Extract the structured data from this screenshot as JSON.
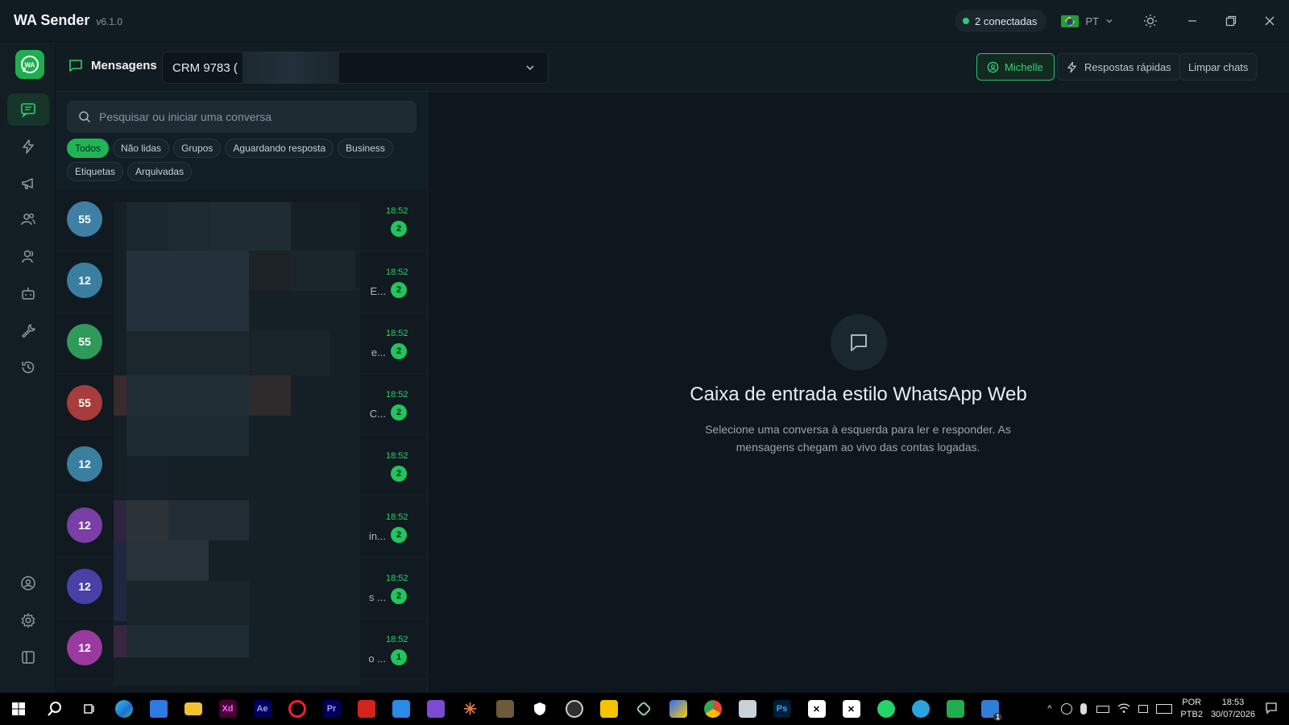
{
  "app": {
    "name": "WA Sender",
    "version": "v6.1.0"
  },
  "titlebar": {
    "connected_label": "2 conectadas",
    "language_code": "PT",
    "theme_icon": "sun-icon",
    "controls": [
      "minimize",
      "maximize",
      "close"
    ]
  },
  "rail": {
    "logo_text": "WA",
    "items": [
      {
        "name": "inbox",
        "icon": "chat-list-icon",
        "active": true
      },
      {
        "name": "automations",
        "icon": "bolt-icon"
      },
      {
        "name": "campaigns",
        "icon": "megaphone-icon"
      },
      {
        "name": "contacts",
        "icon": "users-icon"
      },
      {
        "name": "groups",
        "icon": "user-group-icon"
      },
      {
        "name": "bots",
        "icon": "robot-icon"
      },
      {
        "name": "tools",
        "icon": "wrench-icon"
      },
      {
        "name": "history",
        "icon": "history-icon"
      }
    ],
    "bottom": [
      {
        "name": "account",
        "icon": "account-icon"
      },
      {
        "name": "settings",
        "icon": "gear-icon"
      },
      {
        "name": "collapse",
        "icon": "sidebar-collapse-icon"
      }
    ]
  },
  "header": {
    "title": "Mensagens",
    "account_select_value": "CRM 9783 (",
    "attendant_button": "Michelle",
    "quick_replies_button": "Respostas rápidas",
    "clear_chats_button": "Limpar chats"
  },
  "search": {
    "placeholder": "Pesquisar ou iniciar uma conversa"
  },
  "filters": [
    "Todos",
    "Não lidas",
    "Grupos",
    "Aguardando resposta",
    "Business",
    "Etiquetas",
    "Arquivadas"
  ],
  "active_filter": "Todos",
  "conversations": [
    {
      "avatar_text": "55",
      "avatar_color": "#3f7fa6",
      "time": "18:52",
      "unread": "2",
      "preview_tail": ""
    },
    {
      "avatar_text": "12",
      "avatar_color": "#3b7fa0",
      "time": "18:52",
      "unread": "2",
      "preview_tail": "E..."
    },
    {
      "avatar_text": "55",
      "avatar_color": "#2f9a5a",
      "time": "18:52",
      "unread": "2",
      "preview_tail": "e..."
    },
    {
      "avatar_text": "55",
      "avatar_color": "#a83c3c",
      "time": "18:52",
      "unread": "2",
      "preview_tail": "C..."
    },
    {
      "avatar_text": "12",
      "avatar_color": "#3b7fa0",
      "time": "18:52",
      "unread": "2",
      "preview_tail": ""
    },
    {
      "avatar_text": "12",
      "avatar_color": "#7a3ea6",
      "time": "18:52",
      "unread": "2",
      "preview_tail": "in..."
    },
    {
      "avatar_text": "12",
      "avatar_color": "#4a3fa6",
      "time": "18:52",
      "unread": "2",
      "preview_tail": "s ..."
    },
    {
      "avatar_text": "12",
      "avatar_color": "#9a3aa0",
      "time": "18:52",
      "unread": "1",
      "preview_tail": "o ..."
    }
  ],
  "empty_state": {
    "icon": "chat-bubble-icon",
    "title": "Caixa de entrada estilo WhatsApp Web",
    "subtitle": "Selecione uma conversa à esquerda para ler e responder. As mensagens chegam ao vivo das contas logadas."
  },
  "taskbar": {
    "apps": [
      "windows-start-icon",
      "search-icon",
      "task-view-icon",
      "edge-icon",
      "store-icon",
      "file-explorer-icon",
      "xd-icon",
      "after-effects-icon",
      "opera-icon",
      "premiere-icon",
      "acrobat-icon",
      "outlook-icon",
      "visual-studio-icon",
      "claude-icon",
      "app-icon",
      "defender-icon",
      "obs-icon",
      "app-yellow-icon",
      "app-green-icon",
      "capcut-icon",
      "chrome-icon",
      "notepad-icon",
      "photoshop-icon",
      "capcut-icon",
      "capcut-icon",
      "whatsapp-icon",
      "telegram-icon",
      "wa-sender-icon",
      "app-blue-icon"
    ],
    "tray_language": [
      "POR",
      "PTB2"
    ],
    "time": "18:53",
    "date": "30/07/2026",
    "taskbar_badge": "1"
  }
}
